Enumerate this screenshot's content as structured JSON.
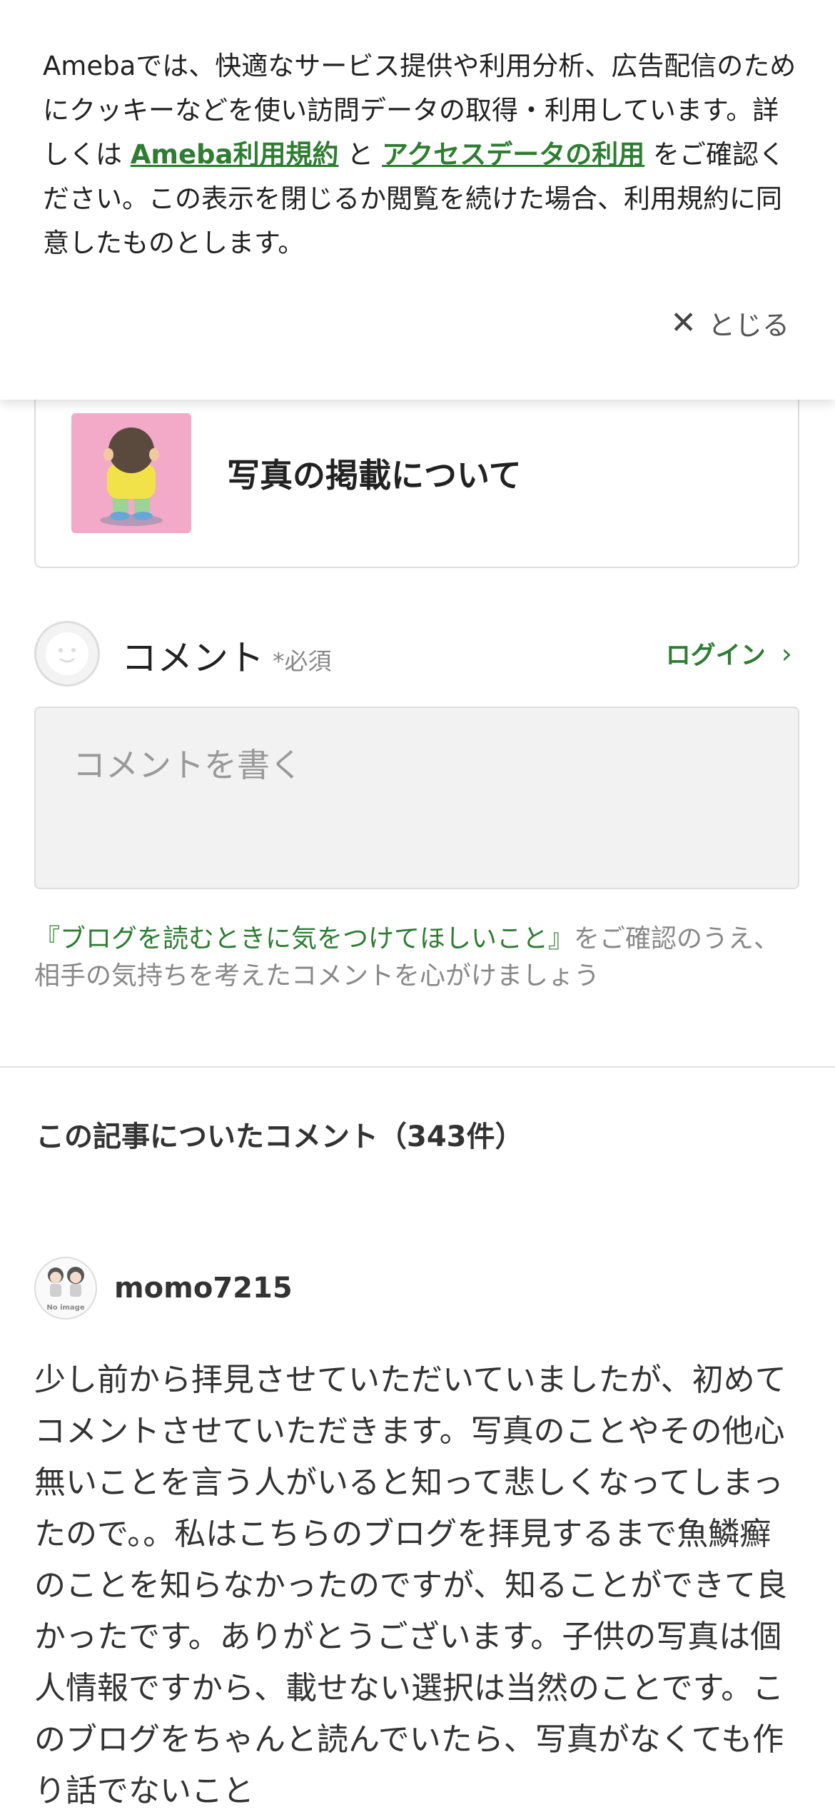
{
  "cookie_banner": {
    "text_before": "Amebaでは、快適なサービス提供や利用分析、広告配信のためにクッキーなどを使い訪問データの取得・利用しています。詳しくは",
    "link1": "Ameba利用規約",
    "conjunction": "と",
    "link2": "アクセスデータの利用",
    "text_after": "をご確認ください。この表示を閉じるか閲覧を続けた場合、利用規約に同意したものとします。",
    "close_label": "とじる"
  },
  "article": {
    "title": "写真の掲載について"
  },
  "comment_form": {
    "label": "コメント",
    "required": "*必須",
    "login_label": "ログイン",
    "placeholder": "コメントを書く",
    "guideline_link": "『ブログを読むときに気をつけてほしいこと』",
    "guideline_text": "をご確認のうえ、相手の気持ちを考えたコメントを心がけましょう"
  },
  "comments": {
    "heading": "この記事についたコメント（343件）",
    "items": [
      {
        "author": "momo7215",
        "avatar_label": "No image",
        "body": "少し前から拝見させていただいていましたが、初めてコメントさせていただきます。写真のことやその他心無いことを言う人がいると知って悲しくなってしまったので。。私はこちらのブログを拝見するまで魚鱗癬のことを知らなかったのですが、知ることができて良かったです。ありがとうございます。子供の写真は個人情報ですから、載せない選択は当然のことです。このブログをちゃんと読んでいたら、写真がなくても作り話でないこと"
      }
    ]
  },
  "colors": {
    "accent_green": "#2e7d32",
    "thumbnail_bg": "#f3a9c8"
  }
}
